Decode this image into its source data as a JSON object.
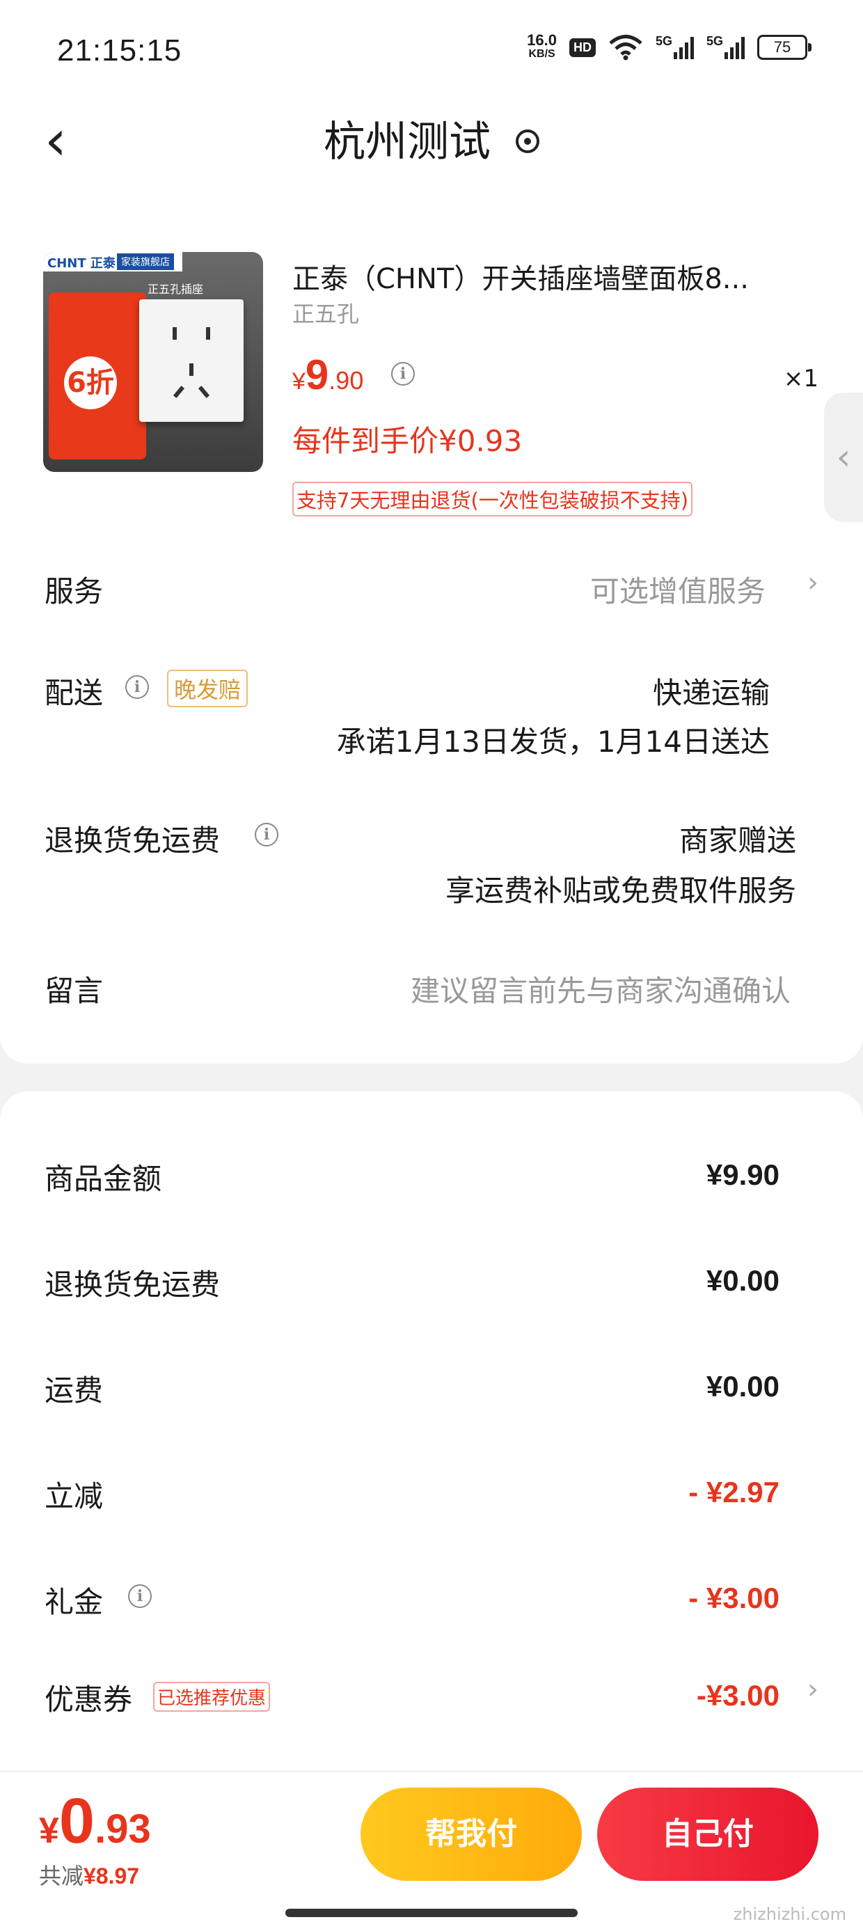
{
  "status_bar": {
    "time": "21:15:15",
    "net_speed_value": "16.0",
    "net_speed_unit": "KB/S",
    "hd_label": "HD",
    "sig1_label": "5G",
    "sig2_label": "5G",
    "battery": "75"
  },
  "nav": {
    "back_icon": "chevron-left-icon",
    "title": "杭州测试",
    "location_icon": "location-pin-icon"
  },
  "product": {
    "thumb_brand": "CHNT 正泰",
    "thumb_store": "家装旗舰店",
    "thumb_label": "正五孔插座",
    "thumb_discount": "6折",
    "title": "正泰（CHNT）开关插座墙壁面板8...",
    "spec": "正五孔",
    "price_symbol": "¥",
    "price_int": "9",
    "price_dec": ".90",
    "quantity": "×1",
    "hand_price": "每件到手价¥0.93",
    "refund_tag": "支持7天无理由退货(一次性包装破损不支持)"
  },
  "rows": {
    "service_label": "服务",
    "service_value": "可选增值服务",
    "delivery_label": "配送",
    "delivery_tag": "晚发赔",
    "delivery_method": "快递运输",
    "delivery_promise": "承诺1月13日发货，1月14日送达",
    "return_label": "退换货免运费",
    "return_value": "商家赠送",
    "return_desc": "享运费补贴或免费取件服务",
    "message_label": "留言",
    "message_placeholder": "建议留言前先与商家沟通确认"
  },
  "summary": {
    "goods_label": "商品金额",
    "goods_value": "¥9.90",
    "return_fee_label": "退换货免运费",
    "return_fee_value": "¥0.00",
    "shipping_label": "运费",
    "shipping_value": "¥0.00",
    "instant_label": "立减",
    "instant_value": "- ¥2.97",
    "gift_label": "礼金",
    "gift_value": "- ¥3.00",
    "coupon_label": "优惠券",
    "coupon_tag": "已选推荐优惠",
    "coupon_value": "-¥3.00"
  },
  "bottom_bar": {
    "total_symbol": "¥",
    "total_int": "0",
    "total_dec": ".93",
    "saved_prefix": "共减",
    "saved_value": "¥8.97",
    "help_pay": "帮我付",
    "self_pay": "自己付",
    "watermark": "zhizhizhi.com"
  },
  "colors": {
    "accent_red": "#e8341c",
    "help_button": "#ffb814",
    "self_button": "#f0243a"
  }
}
